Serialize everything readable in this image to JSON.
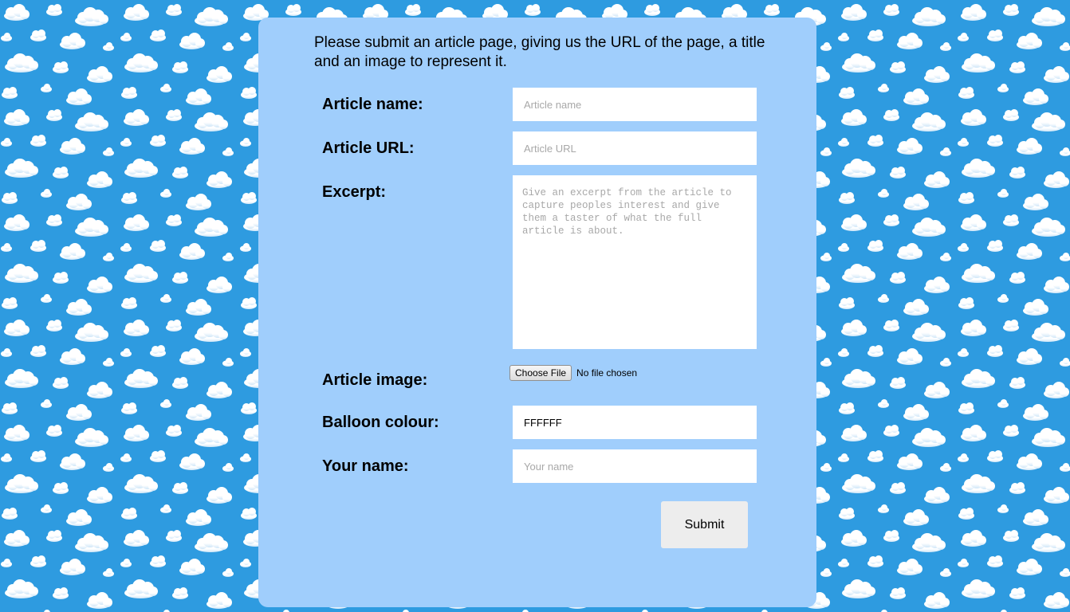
{
  "intro_text": "Please submit an article page, giving us the URL of the page, a title and an image to represent it.",
  "form": {
    "article_name": {
      "label": "Article name:",
      "placeholder": "Article name",
      "value": ""
    },
    "article_url": {
      "label": "Article URL:",
      "placeholder": "Article URL",
      "value": ""
    },
    "excerpt": {
      "label": "Excerpt:",
      "placeholder": "Give an excerpt from the article to capture peoples interest and give them a taster of what the full article is about.",
      "value": ""
    },
    "article_image": {
      "label": "Article image:",
      "button_label": "Choose File",
      "status": "No file chosen"
    },
    "balloon_colour": {
      "label": "Balloon colour:",
      "value": "FFFFFF"
    },
    "your_name": {
      "label": "Your name:",
      "placeholder": "Your name",
      "value": ""
    },
    "submit_label": "Submit"
  },
  "colors": {
    "sky_background": "#2e9be0",
    "panel_background": "#a0cefc",
    "cloud": "#ffffff",
    "button_background": "#ededed"
  }
}
